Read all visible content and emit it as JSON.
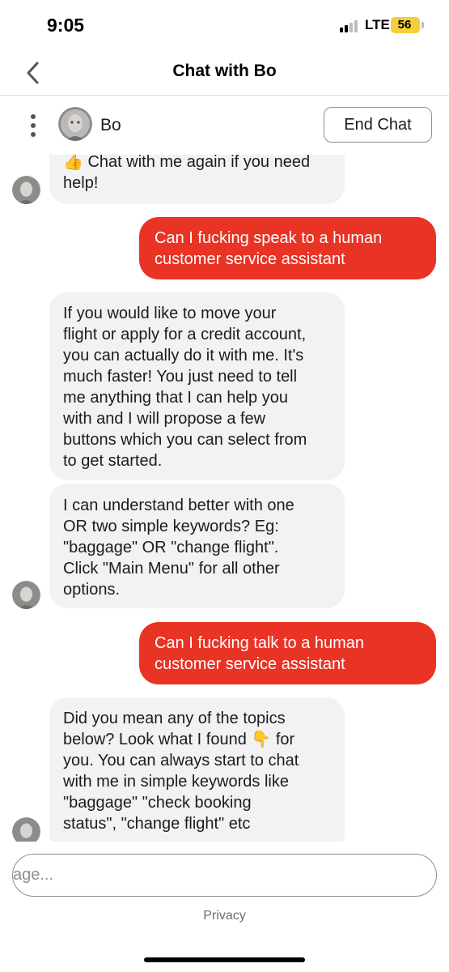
{
  "status_bar": {
    "time": "9:05",
    "network": "LTE",
    "battery": "56",
    "battery_color": "#f4cf3a"
  },
  "header": {
    "title": "Chat with Bo",
    "back_icon": "chevron-left-icon"
  },
  "agent": {
    "name": "Bo",
    "end_chat_label": "End Chat",
    "menu_icon": "vertical-dots-icon"
  },
  "messages": [
    {
      "sender": "bot",
      "lines": [
        "👍 Chat with me again if you need",
        "help!"
      ]
    },
    {
      "sender": "user",
      "lines": [
        "Can I fucking speak to a human",
        "customer service assistant"
      ]
    },
    {
      "sender": "bot",
      "lines": [
        "If you would like to move your",
        "flight or apply for a credit account,",
        "you can actually do it with me. It's",
        "much faster! You just need to tell",
        "me anything that I can help you",
        "with and I will propose a few",
        "buttons which you can select from",
        "to get started."
      ]
    },
    {
      "sender": "bot",
      "lines": [
        "I can understand better with one",
        "OR two simple keywords? Eg:",
        "\"baggage\" OR \"change flight\".",
        "Click \"Main Menu\" for all other",
        "options."
      ]
    },
    {
      "sender": "user",
      "lines": [
        "Can I fucking talk to a human",
        "customer service assistant"
      ]
    },
    {
      "sender": "bot",
      "lines": [
        "Did you mean any of the topics",
        "below? Look what I found 👇 for",
        "you. You can always start to chat",
        "with me in simple keywords like",
        "\"baggage\" \"check booking",
        "status\", \"change flight\" etc"
      ]
    }
  ],
  "composer": {
    "placeholder": "age..."
  },
  "footer": {
    "privacy_label": "Privacy"
  },
  "colors": {
    "user_bubble": "#e93325",
    "bot_bubble": "#f2f2f4"
  }
}
